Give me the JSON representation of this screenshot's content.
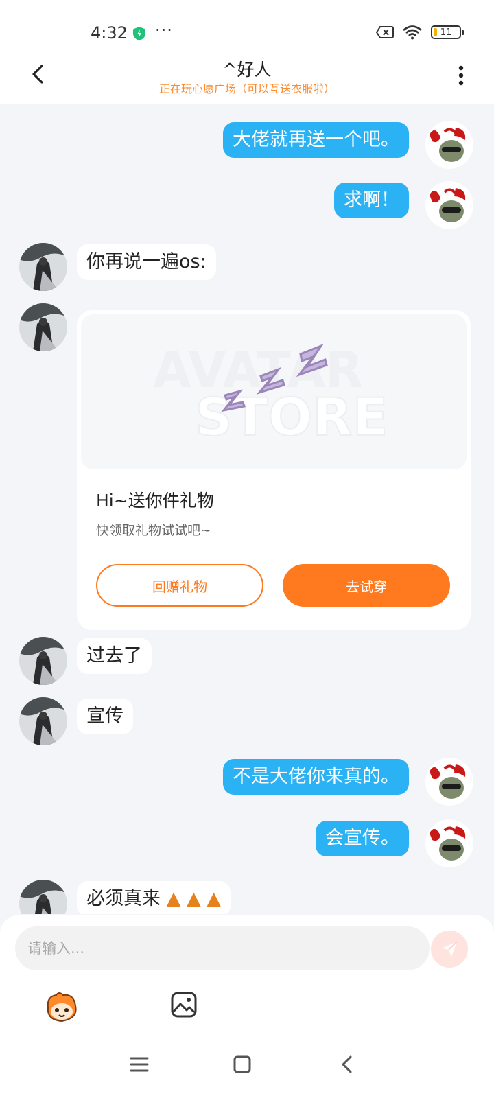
{
  "status_bar": {
    "time": "4:32",
    "more": "···",
    "battery": "11"
  },
  "header": {
    "title": "^好人",
    "subtitle": "正在玩心愿广场（可以互送衣服啦）"
  },
  "messages": [
    {
      "side": "me",
      "text": "大佬就再送一个吧。"
    },
    {
      "side": "me",
      "text": "求啊！"
    },
    {
      "side": "them",
      "text": "你再说一遍os:"
    },
    {
      "side": "them",
      "type": "gift"
    },
    {
      "side": "them",
      "text": "过去了"
    },
    {
      "side": "them",
      "text": "宣传"
    },
    {
      "side": "me",
      "text": "不是大佬你来真的。"
    },
    {
      "side": "me",
      "text": "会宣传。"
    },
    {
      "side": "them",
      "text": "必须真来"
    }
  ],
  "gift_card": {
    "watermark_top": "AVATAR",
    "watermark_bottom": "STORE",
    "title": "Hi~送你件礼物",
    "description": "快领取礼物试试吧~",
    "return_gift_label": "回赠礼物",
    "try_on_label": "去试穿"
  },
  "composer": {
    "placeholder": "请输入..."
  },
  "icons": {
    "back": "chevron-left-icon",
    "more": "more-vertical-icon",
    "send": "send-icon",
    "emoji": "mascot-icon",
    "image": "image-icon",
    "nav_menu": "menu-icon",
    "nav_home": "square-icon",
    "nav_back": "back-icon"
  },
  "colors": {
    "my_bubble": "#2bb2f4",
    "accent_orange": "#ff7a1e",
    "subtitle_orange": "#ff8a2a",
    "chat_bg": "#f3f5f8"
  }
}
